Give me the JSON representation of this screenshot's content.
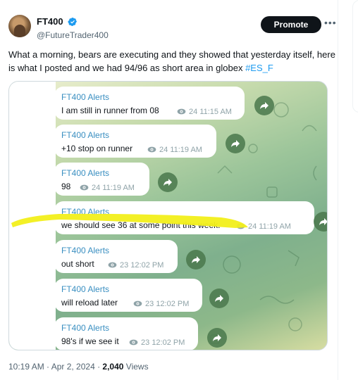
{
  "author": {
    "display_name": "FT400",
    "handle": "@FutureTrader400",
    "verified_icon": "verified-badge-icon"
  },
  "actions": {
    "promote_label": "Promote",
    "more_icon": "more-horizontal-icon"
  },
  "tweet": {
    "text": "What a morning, bears are executing and they showed that yesterday itself, here is what I posted and we had 94/96 as short area in globex ",
    "hashtag": "#ES_F"
  },
  "telegram_messages": [
    {
      "sender": "FT400 Alerts",
      "text": "I am still in runner from 08",
      "views": "24",
      "time": "11:15 AM"
    },
    {
      "sender": "FT400 Alerts",
      "text": "+10 stop on runner",
      "views": "24",
      "time": "11:19 AM"
    },
    {
      "sender": "FT400 Alerts",
      "text": "98",
      "views": "24",
      "time": "11:19 AM"
    },
    {
      "sender": "FT400 Alerts",
      "text": "we should see 36 at some point this week.",
      "views": "24",
      "time": "11:19 AM"
    },
    {
      "sender": "FT400 Alerts",
      "text": "out short",
      "views": "23",
      "time": "12:02 PM"
    },
    {
      "sender": "FT400 Alerts",
      "text": "will reload later",
      "views": "23",
      "time": "12:02 PM"
    },
    {
      "sender": "FT400 Alerts",
      "text": "98's if we see it",
      "views": "23",
      "time": "12:02 PM"
    }
  ],
  "footer": {
    "timestamp": "10:19 AM · Apr 2, 2024 · ",
    "views_count": "2,040",
    "views_label": " Views"
  },
  "colors": {
    "accent": "#1d9bf0",
    "highlight": "#f2ef1a",
    "telegram_sender": "#3a8fc1",
    "forward_button": "#4a784c"
  }
}
